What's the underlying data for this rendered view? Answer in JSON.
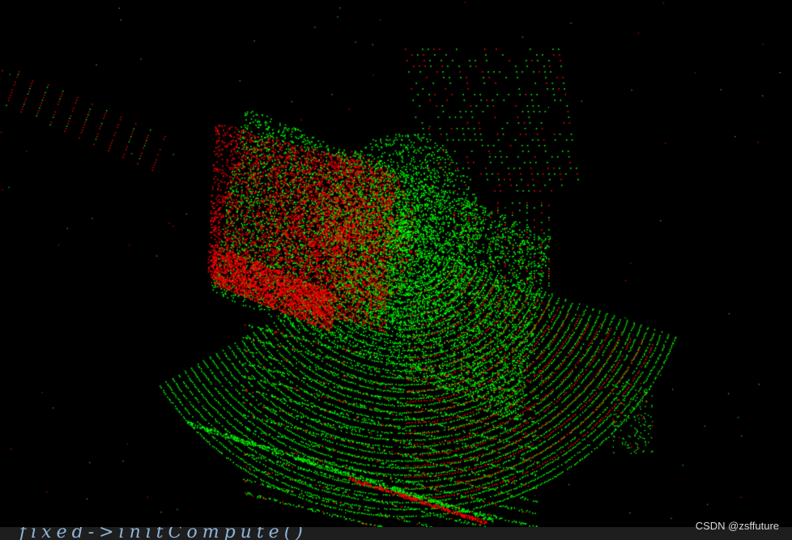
{
  "image": {
    "subject": "lidar-point-cloud-registration",
    "background_color": "#000000",
    "point_colors": {
      "source_cloud": "#00ff00",
      "target_cloud": "#ff0000"
    }
  },
  "code_snippet": "fixed->initCompute()",
  "watermark": "CSDN @zsffuture"
}
